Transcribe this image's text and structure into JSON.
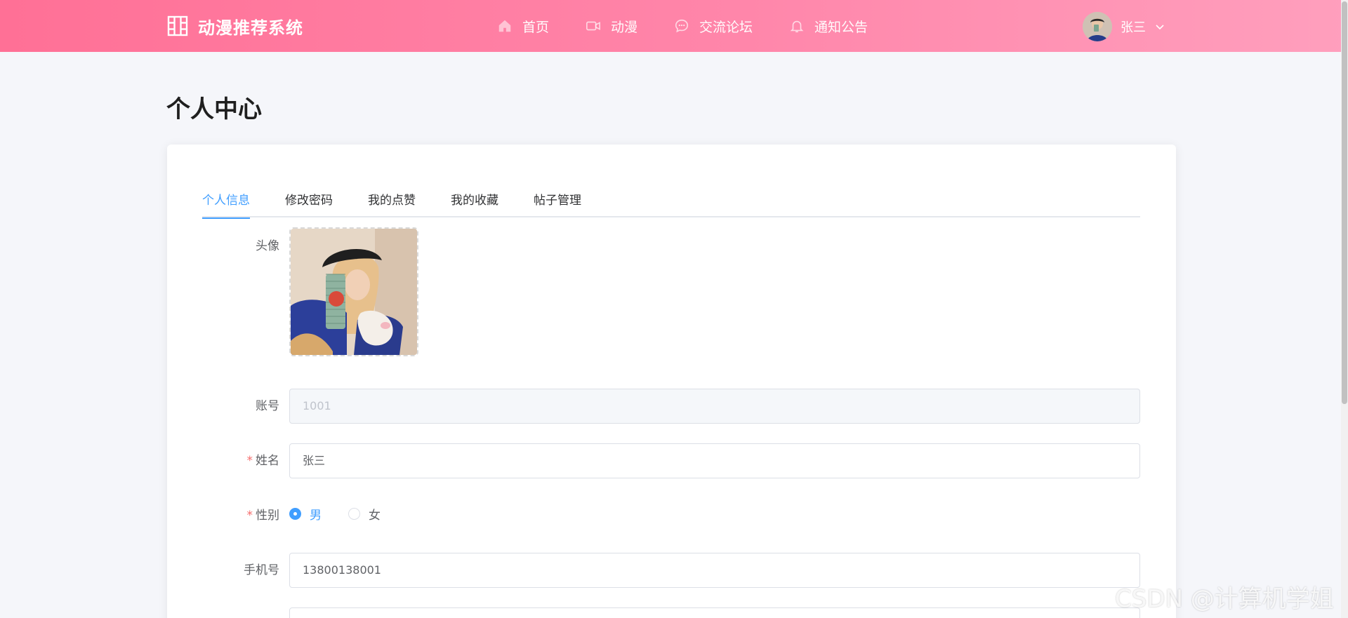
{
  "header": {
    "title": "动漫推荐系统",
    "nav": [
      {
        "label": "首页",
        "icon": "home-icon"
      },
      {
        "label": "动漫",
        "icon": "video-camera-icon"
      },
      {
        "label": "交流论坛",
        "icon": "chat-bubble-icon"
      },
      {
        "label": "通知公告",
        "icon": "bell-icon"
      }
    ],
    "user_name": "张三"
  },
  "page": {
    "title": "个人中心"
  },
  "tabs": [
    {
      "label": "个人信息",
      "active": true
    },
    {
      "label": "修改密码",
      "active": false
    },
    {
      "label": "我的点赞",
      "active": false
    },
    {
      "label": "我的收藏",
      "active": false
    },
    {
      "label": "帖子管理",
      "active": false
    }
  ],
  "form": {
    "avatar_label": "头像",
    "account_label": "账号",
    "account_value": "1001",
    "name_label": "姓名",
    "name_value": "张三",
    "gender_label": "性别",
    "gender_options": [
      "男",
      "女"
    ],
    "gender_selected": "男",
    "phone_label": "手机号",
    "phone_value": "13800138001",
    "required_mark": "*"
  },
  "colors": {
    "header_gradient_start": "#ff7096",
    "header_gradient_end": "#ff9fbd",
    "accent": "#409eff",
    "required": "#f56c6c"
  },
  "watermark": "CSDN @计算机学姐"
}
